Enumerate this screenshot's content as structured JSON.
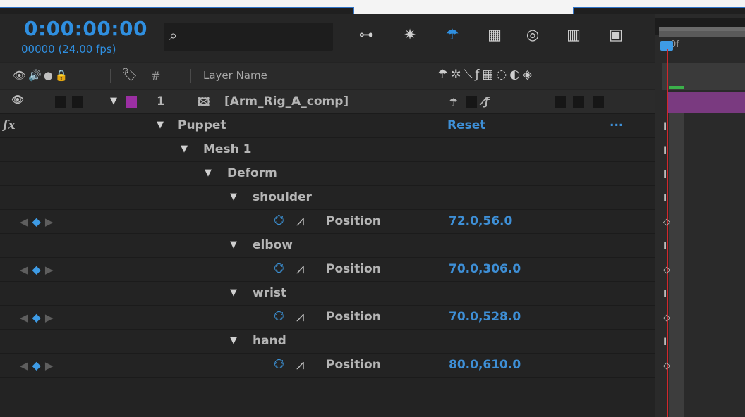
{
  "header": {
    "timecode": "0:00:00:00",
    "frames_fps": "00000 (24.00 fps)",
    "search_icon": "search-icon"
  },
  "columns": {
    "layer_name": "Layer Name",
    "number": "#",
    "switches_label": "switches"
  },
  "layer": {
    "index": "1",
    "name": "[Arm_Rig_A_comp]",
    "label_color": "#9b2fa3"
  },
  "effects": {
    "fx_label": "fx",
    "puppet": "Puppet",
    "reset": "Reset",
    "more": "...",
    "mesh": "Mesh 1",
    "deform": "Deform"
  },
  "pins": [
    {
      "name": "shoulder",
      "prop": "Position",
      "value": "72.0,56.0"
    },
    {
      "name": "elbow",
      "prop": "Position",
      "value": "70.0,306.0"
    },
    {
      "name": "wrist",
      "prop": "Position",
      "value": "70.0,528.0"
    },
    {
      "name": "hand",
      "prop": "Position",
      "value": "80.0,610.0"
    }
  ],
  "timeline": {
    "playhead_label": "0f"
  },
  "colors": {
    "accent": "#2f8fe0",
    "playhead": "#d2272b",
    "layer_bar": "#7a3a80"
  }
}
